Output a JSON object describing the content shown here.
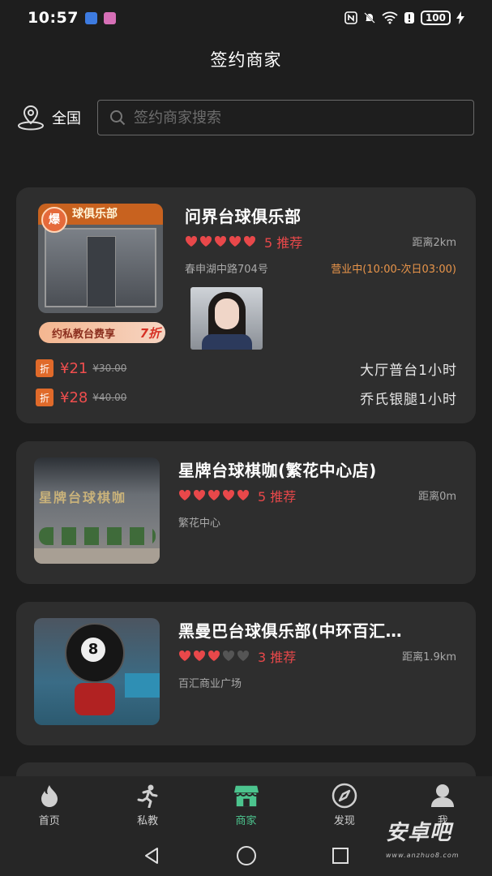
{
  "status_bar": {
    "time": "10:57",
    "battery": "100",
    "icons": [
      "usb-icon",
      "app-icon",
      "nfc-icon",
      "mute-icon",
      "wifi-icon",
      "alert-icon",
      "battery-icon",
      "charging-icon"
    ]
  },
  "header": {
    "title": "签约商家"
  },
  "search": {
    "region": "全国",
    "placeholder": "签约商家搜索"
  },
  "colors": {
    "background": "#1e1e1e",
    "card": "#2e2e2e",
    "accent_red": "#e8484a",
    "accent_orange": "#e9954a",
    "accent_green": "#4cc48e"
  },
  "merchants": [
    {
      "name": "问界台球俱乐部",
      "hearts": 5,
      "rating_text": "5 推荐",
      "distance": "距离2km",
      "address": "春申湖中路704号",
      "hours": "营业中(10:00-次日03:00)",
      "thumb_badge": "爆",
      "thumb_sign": "球俱乐部",
      "promo": {
        "text": "约私教台费享",
        "discount": "7折"
      },
      "deals": [
        {
          "tag": "折",
          "price": "¥21",
          "original": "¥30.00",
          "name": "大厅普台1小时"
        },
        {
          "tag": "折",
          "price": "¥28",
          "original": "¥40.00",
          "name": "乔氏银腿1小时"
        }
      ]
    },
    {
      "name": "星牌台球棋咖(繁花中心店)",
      "hearts": 5,
      "rating_text": "5 推荐",
      "distance": "距离0m",
      "address": "繁花中心",
      "thumb_sign": "星牌台球棋咖"
    },
    {
      "name": "黑曼巴台球俱乐部(中环百汇…",
      "hearts": 3,
      "rating_text": "3 推荐",
      "distance": "距离1.9km",
      "address": "百汇商业广场"
    }
  ],
  "bottom_nav": [
    {
      "label": "首页",
      "icon": "flame-icon",
      "active": false
    },
    {
      "label": "私教",
      "icon": "runner-icon",
      "active": false
    },
    {
      "label": "商家",
      "icon": "store-icon",
      "active": true
    },
    {
      "label": "发现",
      "icon": "compass-icon",
      "active": false
    },
    {
      "label": "我",
      "icon": "user-icon",
      "active": false
    }
  ],
  "watermark": {
    "text": "安卓吧",
    "sub": "www.anzhuo8.com"
  }
}
